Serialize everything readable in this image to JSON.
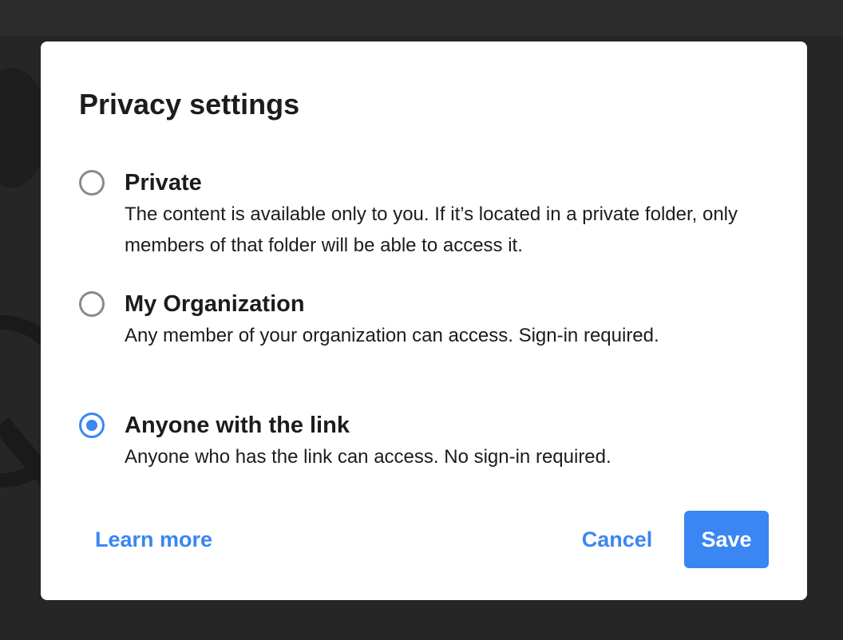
{
  "dialog": {
    "title": "Privacy settings",
    "options": [
      {
        "label": "Private",
        "description": "The content is available only to you. If it’s located in a private folder, only members of that folder will be able to access it.",
        "selected": false
      },
      {
        "label": "My Organization",
        "description": "Any member of your organization can access. Sign-in required.",
        "selected": false
      },
      {
        "label": "Anyone with the link",
        "description": "Anyone who has the link can access. No sign-in required.",
        "selected": true
      }
    ],
    "learn_more_label": "Learn more",
    "cancel_label": "Cancel",
    "save_label": "Save"
  },
  "colors": {
    "accent": "#3a86f2",
    "overlay": "#262626",
    "dialog_bg": "#ffffff",
    "text": "#1c1c1e",
    "radio_unselected": "#8a8a8e"
  }
}
